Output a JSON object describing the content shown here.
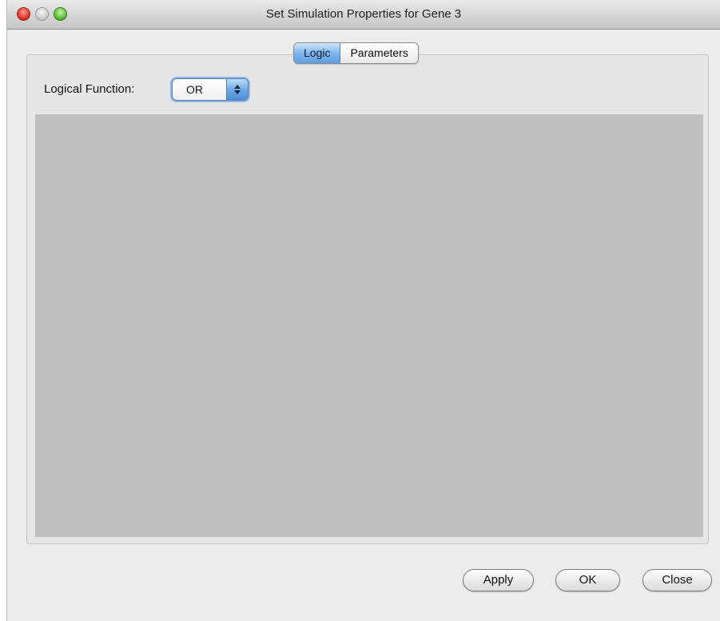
{
  "window": {
    "title": "Set Simulation Properties for Gene 3"
  },
  "tabs": [
    {
      "label": "Logic",
      "selected": true
    },
    {
      "label": "Parameters",
      "selected": false
    }
  ],
  "logic": {
    "function_label": "Logical Function:",
    "function_value": "OR"
  },
  "buttons": {
    "apply": "Apply",
    "ok": "OK",
    "close": "Close"
  },
  "colors": {
    "tab_selected": "#7fb6ec",
    "content_area": "#bfbfbf"
  }
}
